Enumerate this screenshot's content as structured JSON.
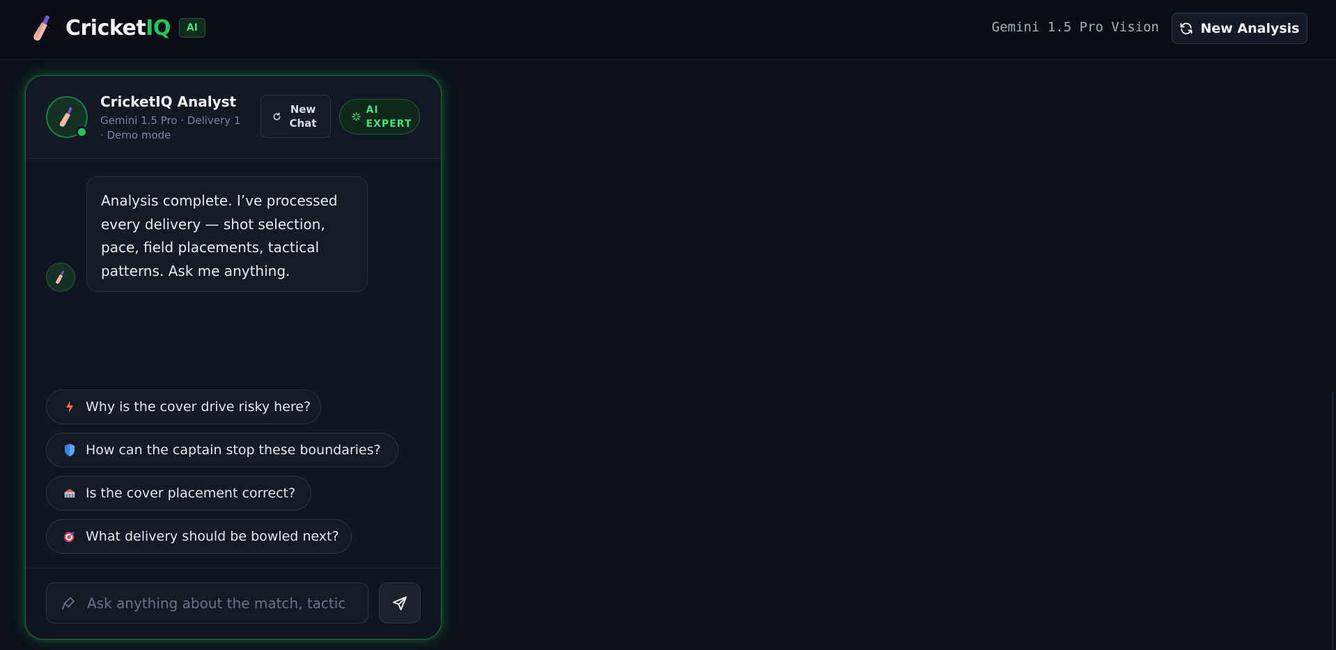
{
  "header": {
    "brand_primary": "Cricket",
    "brand_accent": "IQ",
    "ai_badge": "AI",
    "model_label": "Gemini 1.5 Pro Vision",
    "new_analysis_label": "New Analysis"
  },
  "chat": {
    "agent_name": "CricketIQ Analyst",
    "agent_subtitle": "Gemini 1.5 Pro · Delivery 1 · Demo mode",
    "new_chat_label": "New Chat",
    "ai_expert_label": "AI EXPERT",
    "messages": [
      {
        "role": "assistant",
        "text": "Analysis complete. I’ve processed every delivery — shot selection, pace, field placements, tactical patterns. Ask me anything."
      }
    ],
    "suggestions": [
      {
        "icon": "lightning-icon",
        "label": "Why is the cover drive risky here?"
      },
      {
        "icon": "shield-icon",
        "label": "How can the captain stop these boundaries?"
      },
      {
        "icon": "stadium-icon",
        "label": "Is the cover placement correct?"
      },
      {
        "icon": "target-icon",
        "label": "What delivery should be bowled next?"
      }
    ],
    "input_placeholder": "Ask anything about the match, tactic",
    "input_value": ""
  },
  "colors": {
    "background": "#0b1019",
    "accent_green": "#22c55e",
    "panel": "#0f1521"
  }
}
